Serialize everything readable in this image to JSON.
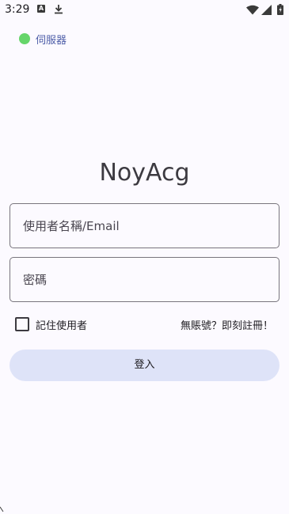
{
  "status_bar": {
    "time": "3:29",
    "icons": [
      "a-notification-icon",
      "download-icon",
      "wifi-icon",
      "signal-icon",
      "battery-icon"
    ],
    "a_icon_letter": "A"
  },
  "server": {
    "label": "伺服器",
    "status_color": "#66d56a"
  },
  "app": {
    "title": "NoyAcg"
  },
  "form": {
    "username_placeholder": "使用者名稱/Email",
    "password_placeholder": "密碼",
    "remember_label": "記住使用者",
    "remember_checked": false,
    "register_link": "無賬號？即刻註冊！",
    "login_label": "登入"
  },
  "colors": {
    "background": "#fcfaff",
    "button": "#dee3f8",
    "server_label": "#4d5da8"
  }
}
